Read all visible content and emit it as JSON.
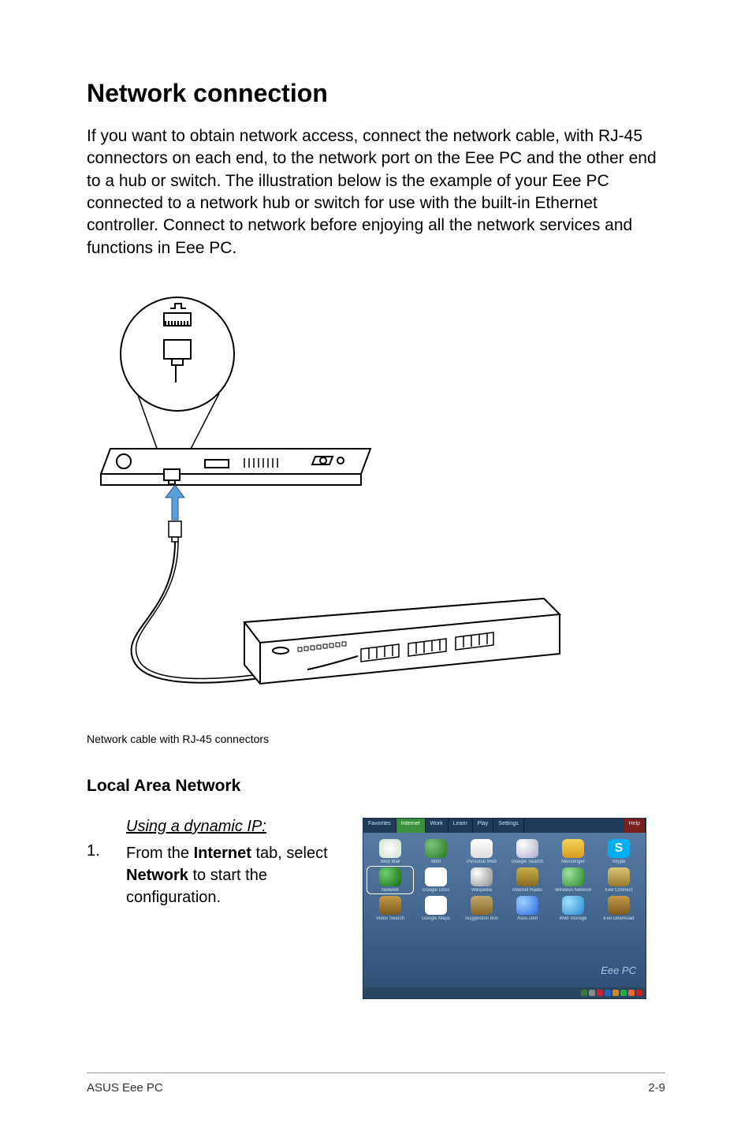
{
  "title": "Network connection",
  "body_text": "If you want to obtain network access, connect the network cable, with RJ-45 connectors on each end, to the network port on the Eee PC and the other end to a hub or switch. The illustration below is the example of your Eee PC connected to a network hub or switch for use with the built-in Ethernet controller. Connect to network before enjoying all the network services and functions in Eee PC.",
  "caption": "Network cable with RJ-45 connectors",
  "subsection": "Local Area Network",
  "step_heading": "Using a dynamic IP:",
  "step": {
    "num": "1.",
    "pre": "From the ",
    "bold1": "Internet",
    "mid": " tab, select ",
    "bold2": "Network",
    "post": " to start the configuration."
  },
  "screenshot": {
    "tabs": [
      "Favorites",
      "Internet",
      "Work",
      "Learn",
      "Play",
      "Settings"
    ],
    "help": "Help",
    "icons": [
      {
        "label": "Web Mail",
        "cls": "stamp"
      },
      {
        "label": "Web",
        "cls": "globe"
      },
      {
        "label": "Personal Web",
        "cls": "house"
      },
      {
        "label": "Google Search",
        "cls": "mag"
      },
      {
        "label": "Messenger",
        "cls": "people"
      },
      {
        "label": "Skype",
        "cls": "skype",
        "text": "S"
      },
      {
        "label": "Network",
        "cls": "net",
        "highlight": true
      },
      {
        "label": "Google Docs",
        "cls": "docs"
      },
      {
        "label": "Wikipedia",
        "cls": "wiki"
      },
      {
        "label": "Internet Radio",
        "cls": "radio"
      },
      {
        "label": "Wireless Networks",
        "cls": "wifi"
      },
      {
        "label": "Eee Connect",
        "cls": "plug"
      },
      {
        "label": "Video Search",
        "cls": "film"
      },
      {
        "label": "Google Maps",
        "cls": "maps"
      },
      {
        "label": "Suggestion Box",
        "cls": "box"
      },
      {
        "label": "Asus.com",
        "cls": "asus"
      },
      {
        "label": "Web Storage",
        "cls": "storage"
      },
      {
        "label": "Eee Download",
        "cls": "dl"
      }
    ],
    "logo": "Eee PC"
  },
  "footer": {
    "left": "ASUS Eee PC",
    "right": "2-9"
  }
}
